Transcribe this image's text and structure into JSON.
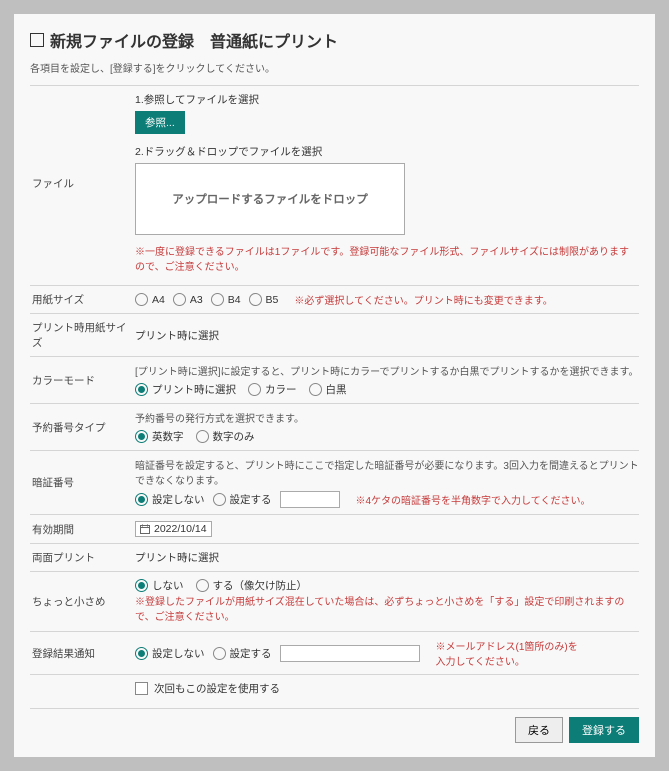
{
  "title": "新規ファイルの登録　普通紙にプリント",
  "subtitle": "各項目を設定し、[登録する]をクリックしてください。",
  "file": {
    "label": "ファイル",
    "step1": "1.参照してファイルを選択",
    "browse": "参照...",
    "step2": "2.ドラッグ＆ドロップでファイルを選択",
    "dropzone": "アップロードするファイルをドロップ",
    "note": "※一度に登録できるファイルは1ファイルです。登録可能なファイル形式、ファイルサイズには制限がありますので、ご注意ください。"
  },
  "paperSize": {
    "label": "用紙サイズ",
    "options": [
      "A4",
      "A3",
      "B4",
      "B5"
    ],
    "note": "※必ず選択してください。プリント時にも変更できます。"
  },
  "printPaperSize": {
    "label": "プリント時用紙サイズ",
    "value": "プリント時に選択"
  },
  "colorMode": {
    "label": "カラーモード",
    "hint": "[プリント時に選択]に設定すると、プリント時にカラーでプリントするか白黒でプリントするかを選択できます。",
    "options": [
      "プリント時に選択",
      "カラー",
      "白黒"
    ],
    "selected": 0
  },
  "reserveType": {
    "label": "予約番号タイプ",
    "hint": "予約番号の発行方式を選択できます。",
    "options": [
      "英数字",
      "数字のみ"
    ],
    "selected": 0
  },
  "pin": {
    "label": "暗証番号",
    "hint": "暗証番号を設定すると、プリント時にここで指定した暗証番号が必要になります。3回入力を間違えるとプリントできなくなります。",
    "options": [
      "設定しない",
      "設定する"
    ],
    "selected": 0,
    "note": "※4ケタの暗証番号を半角数字で入力してください。"
  },
  "expiry": {
    "label": "有効期間",
    "value": "2022/10/14"
  },
  "duplex": {
    "label": "両面プリント",
    "value": "プリント時に選択"
  },
  "shrink": {
    "label": "ちょっと小さめ",
    "options": [
      "しない",
      "する（像欠け防止）"
    ],
    "selected": 0,
    "note": "※登録したファイルが用紙サイズ混在していた場合は、必ずちょっと小さめを「する」設定で印刷されますので、ご注意ください。"
  },
  "notify": {
    "label": "登録結果通知",
    "options": [
      "設定しない",
      "設定する"
    ],
    "selected": 0,
    "note": "※メールアドレス(1箇所のみ)を入力してください。"
  },
  "reuse": {
    "label": "次回もこの設定を使用する"
  },
  "footer": {
    "back": "戻る",
    "submit": "登録する"
  }
}
